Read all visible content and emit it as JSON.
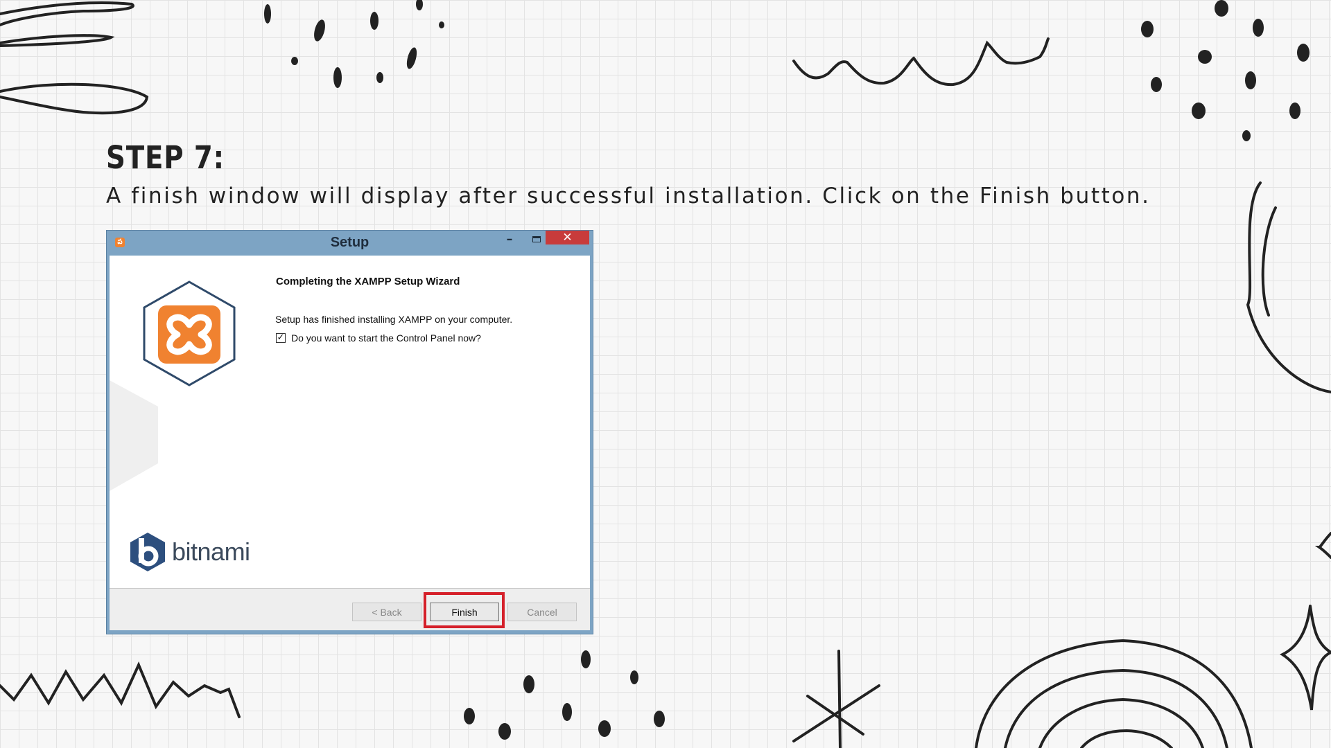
{
  "slide": {
    "step_title": "STEP 7:",
    "instruction": "A finish window will display after successful installation. Click on the Finish button."
  },
  "window": {
    "title": "Setup",
    "title_icon": "xampp-icon",
    "controls": {
      "minimize": "–",
      "close": "✕"
    },
    "heading": "Completing the XAMPP Setup Wizard",
    "message": "Setup has finished installing XAMPP on your computer.",
    "checkbox": {
      "label": "Do you want to start the Control Panel now?",
      "checked": true,
      "mark": "✓"
    },
    "brand_logo": "xampp-logo",
    "brand_text": "bitnami",
    "buttons": {
      "back": "< Back",
      "finish": "Finish",
      "cancel": "Cancel"
    }
  },
  "colors": {
    "titlebar": "#7da4c4",
    "close": "#c83b3b",
    "xampp_orange": "#f08230",
    "highlight": "#d5202a",
    "bitnami_blue": "#2d4f7e"
  }
}
